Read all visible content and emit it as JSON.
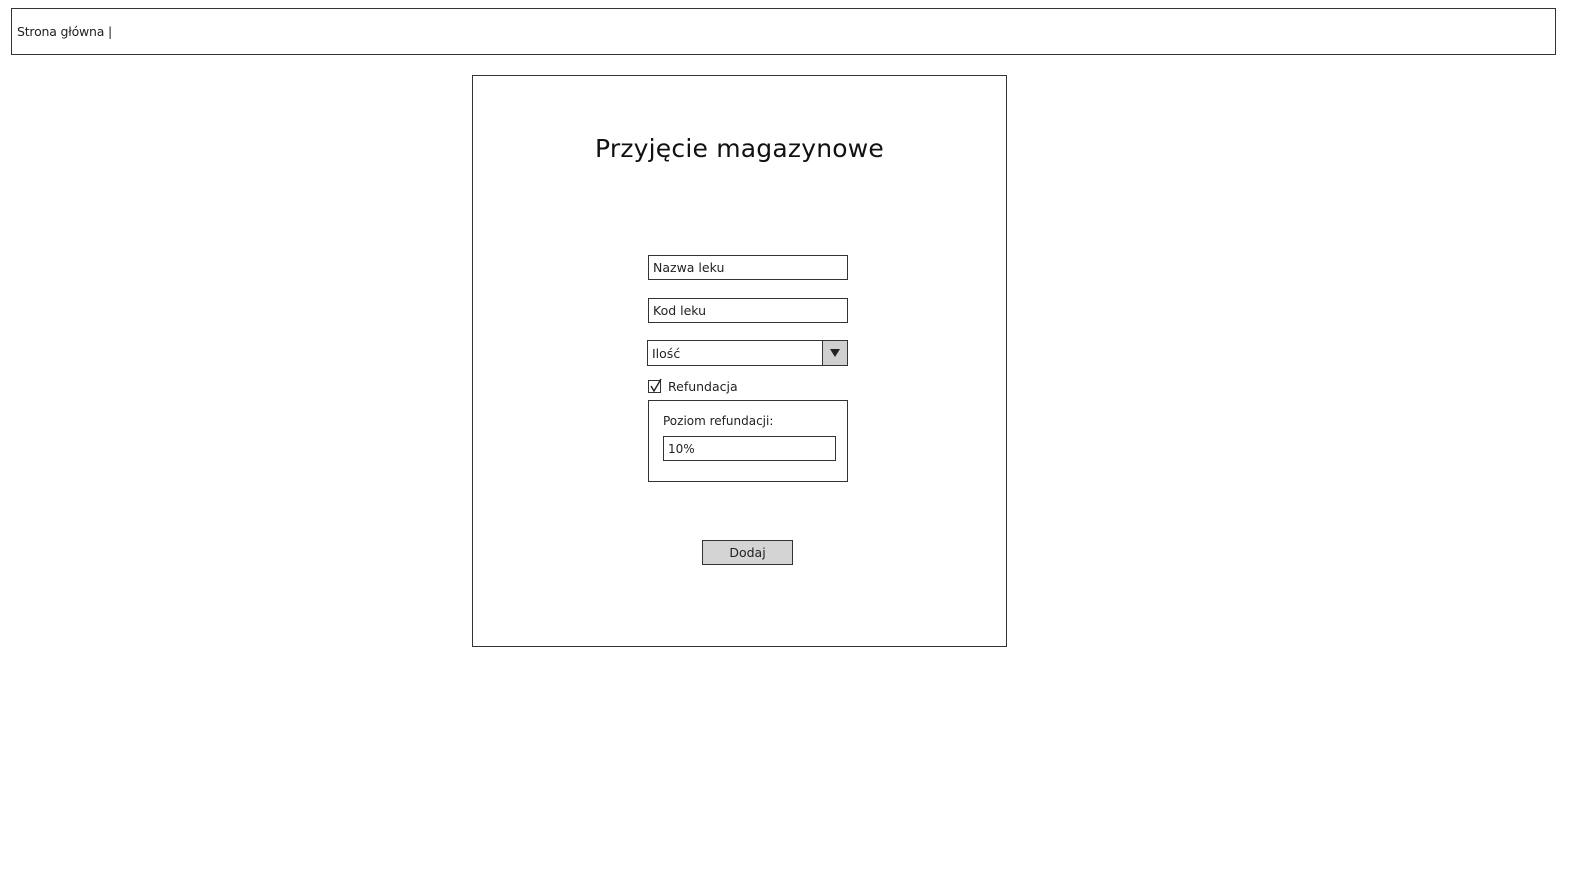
{
  "topbar": {
    "nav_text": "Strona główna |"
  },
  "form": {
    "title": "Przyjęcie magazynowe",
    "drug_name_placeholder": "Nazwa leku",
    "drug_code_placeholder": "Kod leku",
    "quantity": {
      "selected": "Ilość",
      "icon": "triangle-down"
    },
    "refund_checkbox": {
      "label": "Refundacja",
      "checked": true
    },
    "refund_level": {
      "label": "Poziom refundacji:",
      "value": "10%"
    },
    "submit_label": "Dodaj"
  }
}
